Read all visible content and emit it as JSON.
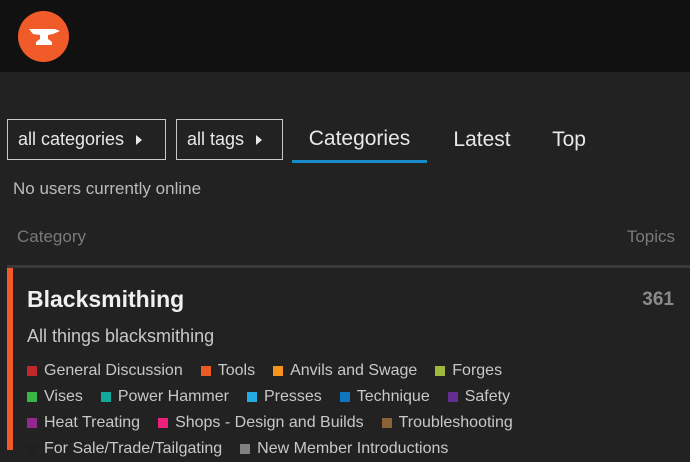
{
  "header": {
    "logo_icon": "anvil-icon",
    "logo_color": "#f15a29"
  },
  "nav": {
    "categories_dropdown": "all categories",
    "tags_dropdown": "all tags",
    "tabs": [
      {
        "label": "Categories",
        "active": true
      },
      {
        "label": "Latest",
        "active": false
      },
      {
        "label": "Top",
        "active": false
      }
    ],
    "active_tab_color": "#1a8bc9"
  },
  "status": {
    "online_text": "No users currently online"
  },
  "table": {
    "col_category": "Category",
    "col_topics": "Topics"
  },
  "category": {
    "name": "Blacksmithing",
    "topics": "361",
    "description": "All things blacksmithing",
    "color": "#f15a29",
    "subcategories": [
      {
        "name": "General Discussion",
        "color": "#c0282d"
      },
      {
        "name": "Tools",
        "color": "#ee5a24"
      },
      {
        "name": "Anvils and Swage",
        "color": "#f7941d"
      },
      {
        "name": "Forges",
        "color": "#9eb83b"
      },
      {
        "name": "Vises",
        "color": "#3ab54a"
      },
      {
        "name": "Power Hammer",
        "color": "#12a89d"
      },
      {
        "name": "Presses",
        "color": "#25aae1"
      },
      {
        "name": "Technique",
        "color": "#0e76bd"
      },
      {
        "name": "Safety",
        "color": "#652d90"
      },
      {
        "name": "Heat Treating",
        "color": "#92278f"
      },
      {
        "name": "Shops - Design and Builds",
        "color": "#ed207b"
      },
      {
        "name": "Troubleshooting",
        "color": "#8c6238"
      },
      {
        "name": "For Sale/Trade/Tailgating",
        "color": "#231f20"
      },
      {
        "name": "New Member Introductions",
        "color": "#808281"
      }
    ]
  }
}
